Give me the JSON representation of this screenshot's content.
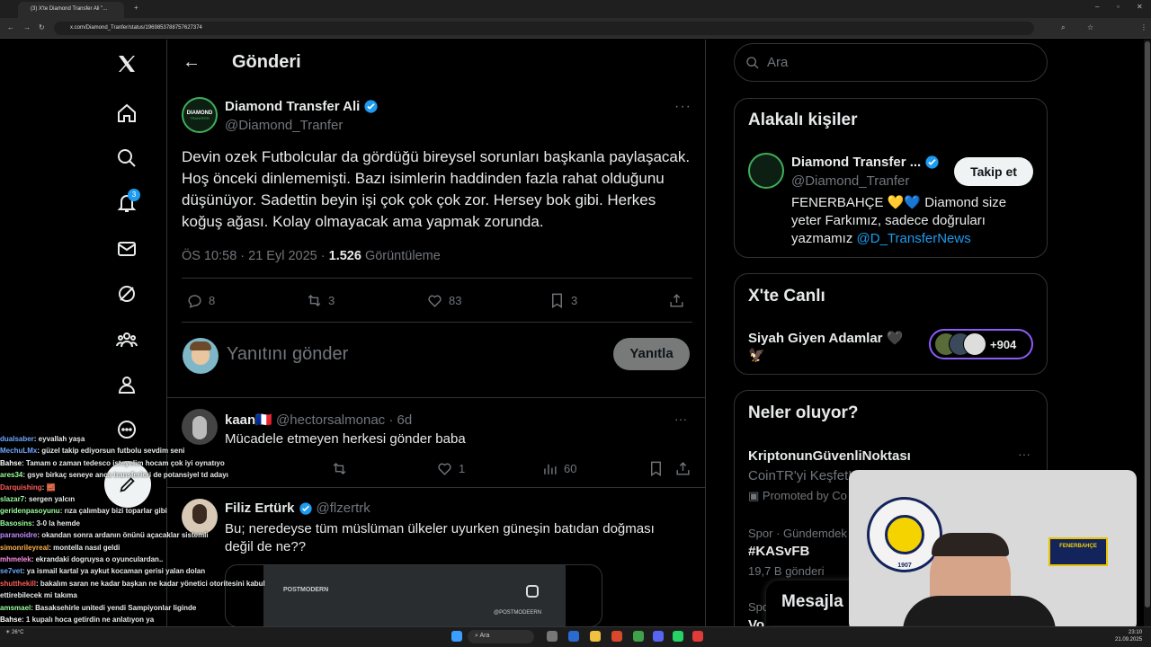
{
  "browser": {
    "tab_title": "(3) X'te Diamond Transfer Ali \"...",
    "url": "x.com/Diamond_Tranfer/status/1969853788757627374"
  },
  "nav": {
    "notif_count": "3"
  },
  "header": {
    "title": "Gönderi"
  },
  "post": {
    "name": "Diamond Transfer Ali",
    "handle": "@Diamond_Tranfer",
    "avatar_text": "DIAMOND",
    "avatar_sub": "TRANSFER",
    "text": "Devin ozek Futbolcular da gördüğü bireysel sorunları başkanla paylaşacak. Hoş önceki dinlememişti. Bazı isimlerin haddinden fazla rahat olduğunu düşünüyor. Sadettin beyin işi çok çok çok zor. Hersey bok gibi. Herkes koğuş ağası. Kolay olmayacak ama yapmak zorunda.",
    "time": "ÖS 10:58 · 21 Eyl 2025 · ",
    "views": "1.526",
    "views_label": " Görüntüleme",
    "replies": "8",
    "reposts": "3",
    "likes": "83",
    "bookmarks": "3"
  },
  "reply_box": {
    "placeholder": "Yanıtını gönder",
    "button": "Yanıtla"
  },
  "replies": [
    {
      "name": "kaan🇫🇷",
      "handle": "@hectorsalmonac · 6d",
      "text": "Mücadele etmeyen herkesi gönder baba",
      "likes": "1",
      "views": "60"
    },
    {
      "name": "Filiz Ertürk",
      "handle": "@flzertrk",
      "text": "Bu; neredeyse tüm müslüman ülkeler uyurken güneşin batıdan doğması değil de ne??",
      "media_brand": "POSTMODERN",
      "media_handle": "@POSTMODEERN"
    }
  ],
  "search": {
    "placeholder": "Ara"
  },
  "related": {
    "title": "Alakalı kişiler",
    "name": "Diamond Transfer ...",
    "handle": "@Diamond_Tranfer",
    "follow": "Takip et",
    "bio": "FENERBAHÇE 💛💙 Diamond size yeter Farkımız, sadece doğruları yazmamız ",
    "bio_link": "@D_TransferNews"
  },
  "live": {
    "title": "X'te Canlı",
    "name": "Siyah Giyen Adamlar 🖤🦅",
    "count": "+904"
  },
  "trends": {
    "title": "Neler oluyor?",
    "promo_name": "KriptonunGüvenliNoktası",
    "promo_text": "CoinTR'yi Keşfet!",
    "promo_label": "Promoted by Co",
    "trend_cat": "Spor · Gündemdek",
    "trend_tag": "#KASvFB",
    "trend_count": "19,7 B gönderi",
    "trend2_cat": "Spor",
    "trend2_tag": "Vo"
  },
  "messages": {
    "label": "Mesajla"
  },
  "chat": [
    {
      "user": "dualsaber",
      "color": "#6ea8ff",
      "msg": ": eyvallah yaşa"
    },
    {
      "user": "MechuLMx",
      "color": "#6ea8ff",
      "msg": ": güzel takip ediyorsun futbolu sevdim seni"
    },
    {
      "user": "Bahse",
      "color": "#ffffff",
      "msg": ": Tamam o zaman tedesco isteyelim hocam çok iyi oynatıyo"
    },
    {
      "user": "ares34",
      "color": "#9cff9c",
      "msg": ": gsye birkaç seneye anca transferleri de potansiyel td adayı"
    },
    {
      "user": "Darquishing",
      "color": "#ff5b5b",
      "msg": ": 🧱"
    },
    {
      "user": "slazar7",
      "color": "#9cff9c",
      "msg": ": sergen yalcın"
    },
    {
      "user": "geridenpasoyunu",
      "color": "#9cff9c",
      "msg": ": rıza çalımbay bizi toparlar gibi"
    },
    {
      "user": "Basosins",
      "color": "#9cff9c",
      "msg": ": 3-0 la hemde"
    },
    {
      "user": "paranoidre",
      "color": "#c28bff",
      "msg": ": okandan sonra ardanın önünü açacaklar sistemli"
    },
    {
      "user": "simonrileyreal",
      "color": "#ffb14d",
      "msg": ": montella nasıl geldi"
    },
    {
      "user": "mhmelek",
      "color": "#ff8ce0",
      "msg": ": ekrandaki dogruysa o oyunculardan.."
    },
    {
      "user": "se7vet",
      "color": "#6ea8ff",
      "msg": ": ya ismail kartal ya aykut kocaman gerisi yalan dolan"
    },
    {
      "user": "shutthekill",
      "color": "#ff5b5b",
      "msg": ": bakalım saran ne kadar başkan ne kadar yönetici otoritesini kabul ettirebilecek mi takıma"
    },
    {
      "user": "amsmael",
      "color": "#9cff9c",
      "msg": ": Basaksehirle unitedi yendi Sampiyonlar liginde"
    },
    {
      "user": "Bahse",
      "color": "#ffffff",
      "msg": ": 1 kupalı hoca getirdin ne anlatıyon ya"
    }
  ],
  "webcam": {
    "logo_text": "FENERBAHÇE SPOR KULÜBÜ",
    "year": "1907",
    "sign": "FENERBAHÇE"
  },
  "taskbar": {
    "weather": "26°C",
    "search": "Ara",
    "time": "23:10",
    "date": "21.09.2025"
  },
  "colors": {
    "accent": "#1d9bf0",
    "bg": "#000000",
    "border": "#2f3336",
    "muted": "#71767b",
    "live": "#8b5cf6"
  }
}
